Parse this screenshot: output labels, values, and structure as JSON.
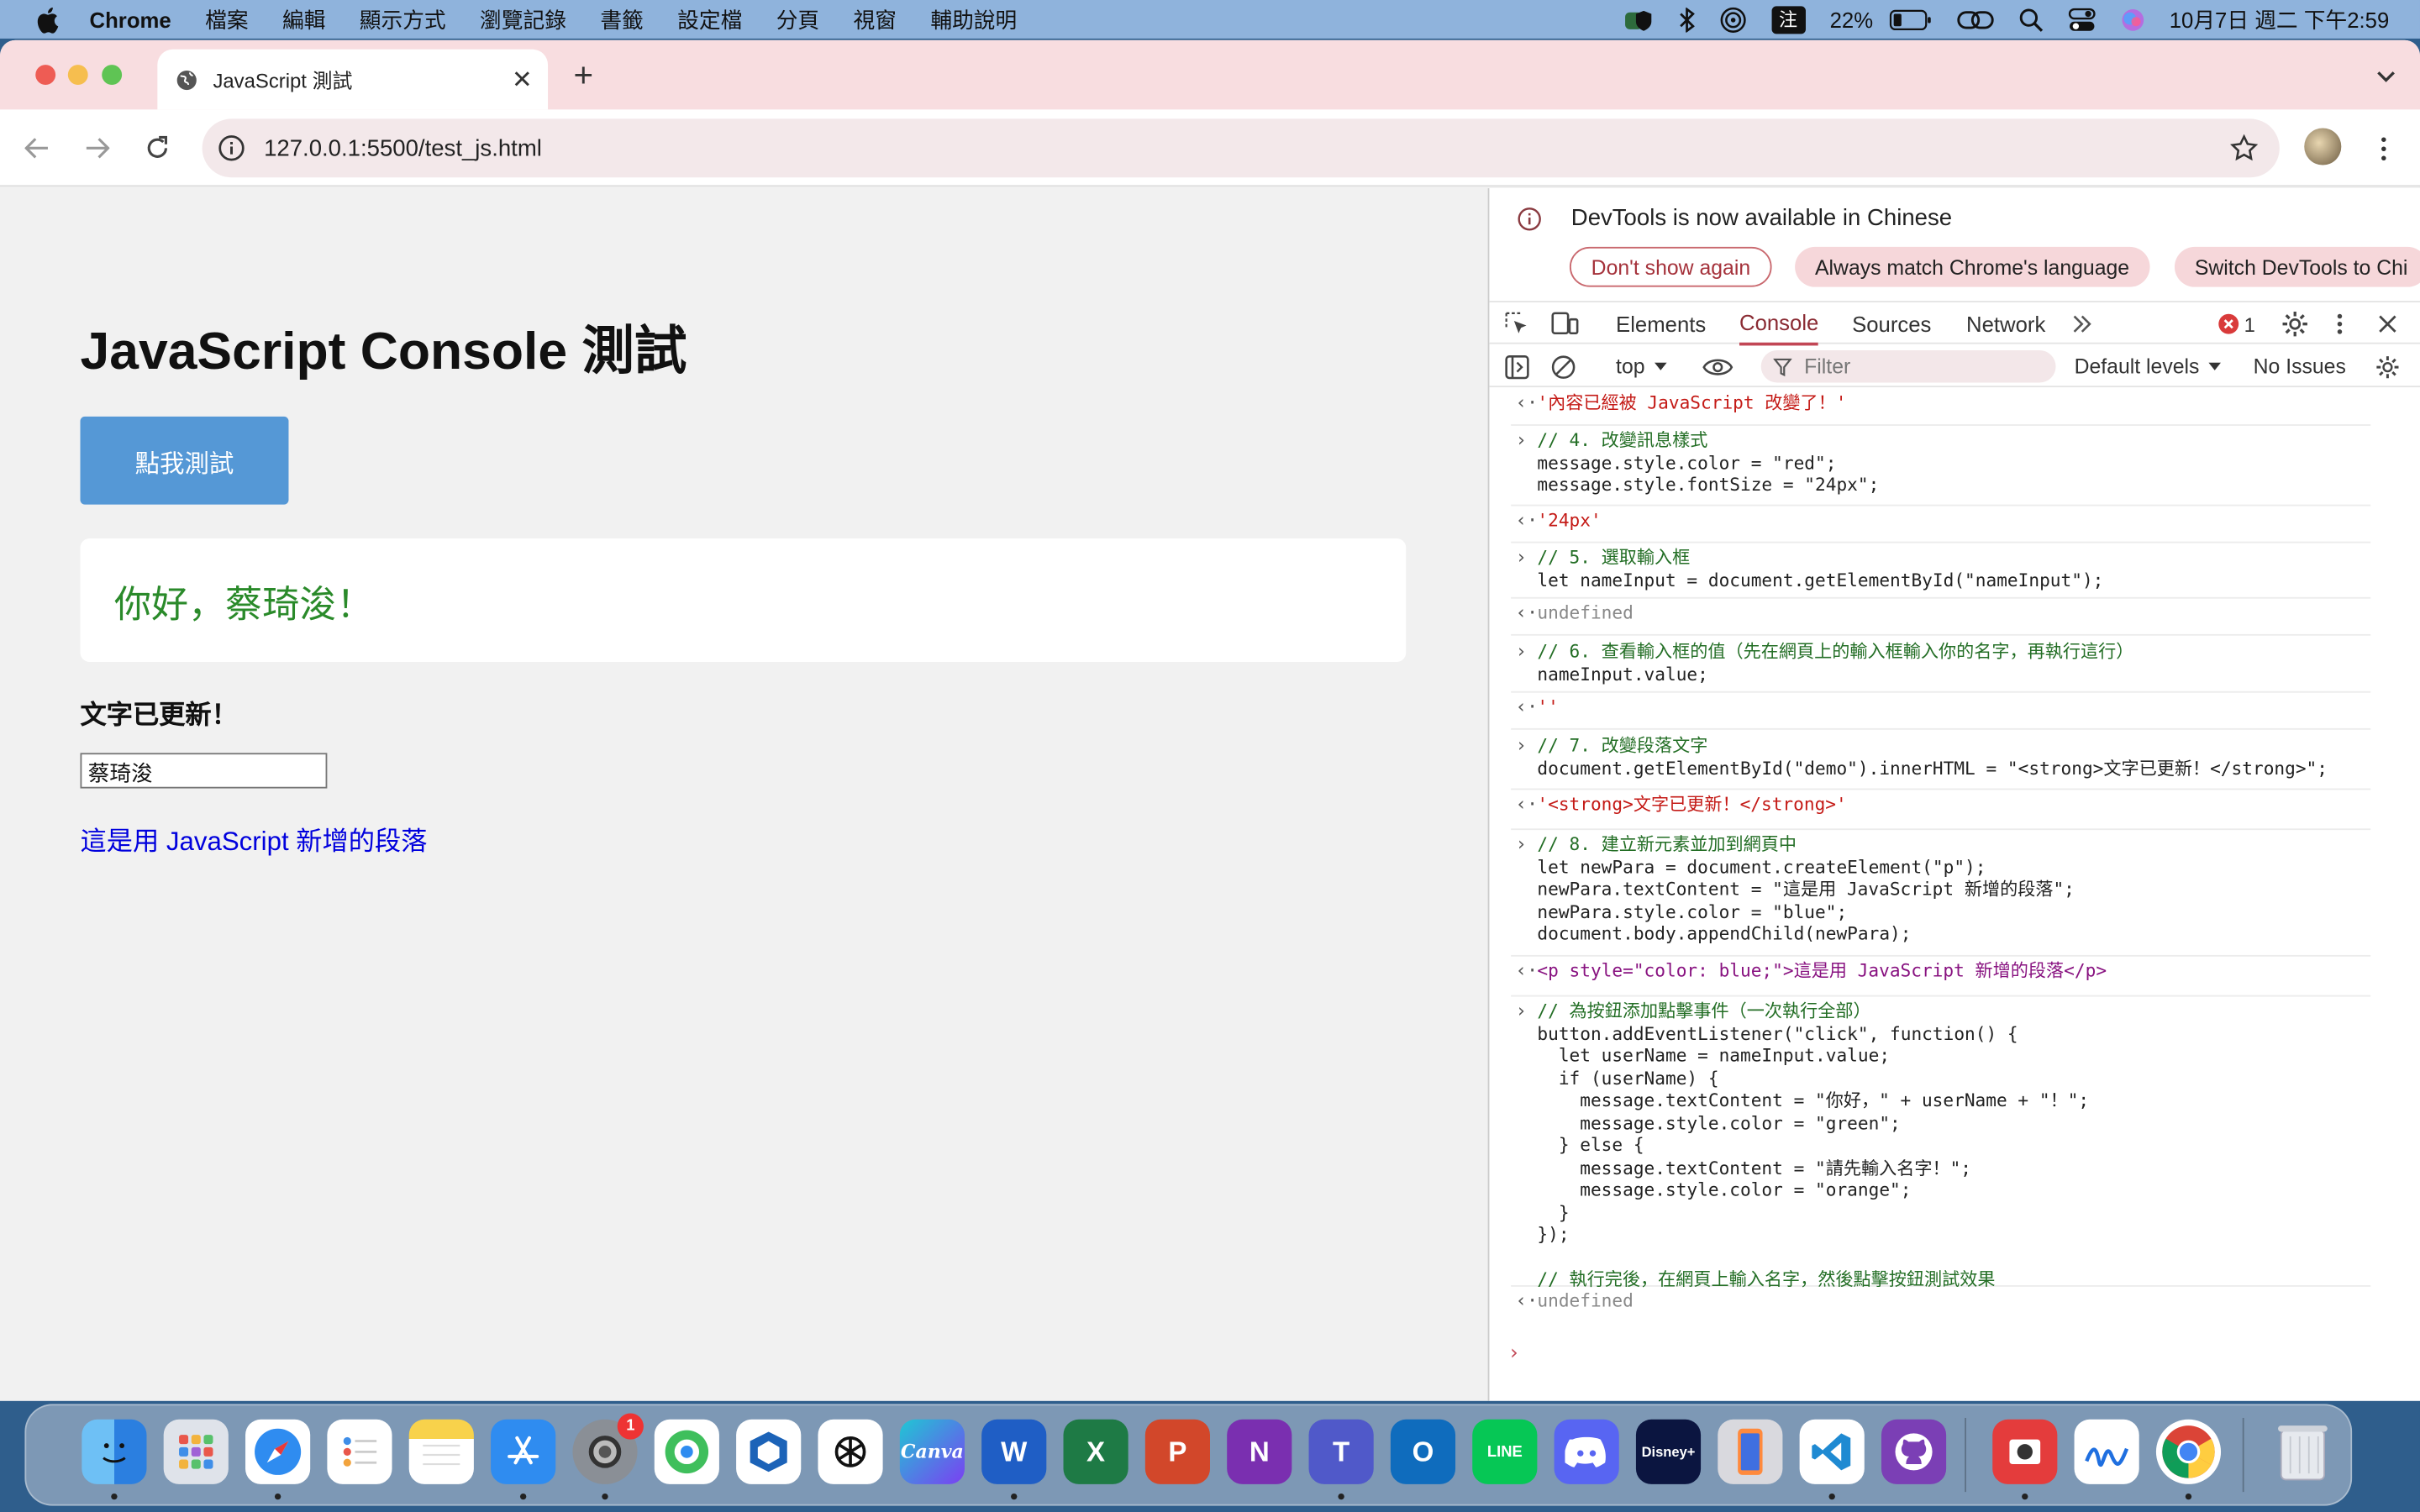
{
  "menubar": {
    "app": "Chrome",
    "items": [
      "檔案",
      "編輯",
      "顯示方式",
      "瀏覽記錄",
      "書籤",
      "設定檔",
      "分頁",
      "視窗",
      "輔助說明"
    ],
    "input_method": "注",
    "battery": "22%",
    "clock": "10月7日 週二 下午2:59"
  },
  "tab": {
    "title": "JavaScript 測試"
  },
  "toolbar": {
    "url": "127.0.0.1:5500/test_js.html"
  },
  "page": {
    "heading": "JavaScript Console 測試",
    "button": "點我測試",
    "message": "你好，蔡琦浚！",
    "demo": "文字已更新！",
    "input_value": "蔡琦浚",
    "new_para": "這是用 JavaScript 新增的段落"
  },
  "devtools": {
    "info": "DevTools is now available in Chinese",
    "btn_dont_show": "Don't show again",
    "btn_match": "Always match Chrome's language",
    "btn_switch": "Switch DevTools to Chi",
    "tabs": [
      "Elements",
      "Console",
      "Sources",
      "Network"
    ],
    "error_count": "1",
    "context": "top",
    "filter_placeholder": "Filter",
    "levels": "Default levels",
    "issues": "No Issues"
  },
  "console": {
    "r1": "'內容已經被 JavaScript 改變了！'",
    "c4a": "// 4. 改變訊息樣式",
    "c4b": "message.style.color = \"red\";",
    "c4c": "message.style.fontSize = \"24px\";",
    "r4": "'24px'",
    "c5a": "// 5. 選取輸入框",
    "c5b": "let nameInput = document.getElementById(\"nameInput\");",
    "r5": "undefined",
    "c6a": "// 6. 查看輸入框的值（先在網頁上的輸入框輸入你的名字，再執行這行）",
    "c6b": "nameInput.value;",
    "r6": "''",
    "c7a": "// 7. 改變段落文字",
    "c7b": "document.getElementById(\"demo\").innerHTML = \"<strong>文字已更新！</strong>\";",
    "r7": "'<strong>文字已更新！</strong>'",
    "c8a": "// 8. 建立新元素並加到網頁中",
    "c8b": "let newPara = document.createElement(\"p\");",
    "c8c": "newPara.textContent = \"這是用 JavaScript 新增的段落\";",
    "c8d": "newPara.style.color = \"blue\";",
    "c8e": "document.body.appendChild(newPara);",
    "r8": "<p style=\"color: blue;\">這是用 JavaScript 新增的段落</p>",
    "c9a": "// 為按鈕添加點擊事件（一次執行全部）",
    "c9b": "button.addEventListener(\"click\", function() {",
    "c9c": "  let userName = nameInput.value;",
    "c9d": "  if (userName) {",
    "c9e": "    message.textContent = \"你好，\" + userName + \"！\";",
    "c9f": "    message.style.color = \"green\";",
    "c9g": "  } else {",
    "c9h": "    message.textContent = \"請先輸入名字！\";",
    "c9i": "    message.style.color = \"orange\";",
    "c9j": "  }",
    "c9k": "});",
    "c9l": "// 執行完後，在網頁上輸入名字，然後點擊按鈕測試效果",
    "r9": "undefined"
  },
  "dock": {
    "badge": "1",
    "apps": [
      "Finder",
      "Launchpad",
      "Safari",
      "Reminders",
      "Notes",
      "App Store",
      "System Settings",
      "Find My",
      "VirtualBox",
      "ChatGPT",
      "Canva",
      "Word",
      "Excel",
      "PowerPoint",
      "OneNote",
      "Teams",
      "Outlook",
      "LINE",
      "Discord",
      "Disney+",
      "iPhone Mirroring",
      "VS Code",
      "GitHub Desktop",
      "Photo Booth",
      "Freeform",
      "Chrome",
      "Trash"
    ],
    "canva_label": "Canva",
    "word_label": "W",
    "excel_label": "X",
    "ppt_label": "P",
    "onenote_label": "N",
    "teams_label": "T",
    "outlook_label": "O",
    "line_label": "LINE",
    "disney_label": "Disney+"
  }
}
